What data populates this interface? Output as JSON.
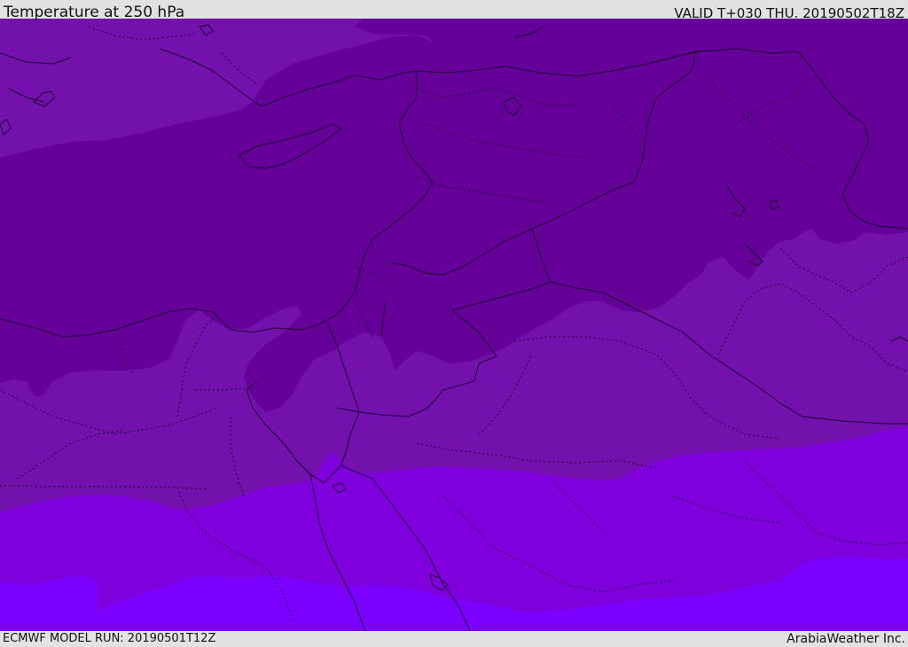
{
  "header": {
    "title": "Temperature at 250 hPa",
    "valid": "VALID T+030 THU. 20190502T18Z"
  },
  "footer": {
    "model_run": "ECMWF MODEL RUN: 20190501T12Z",
    "credit": "ArabiaWeather Inc."
  },
  "map": {
    "field": "temperature_250hPa",
    "palette": {
      "coldest": "#650098",
      "cold": "#7311ad",
      "mid": "#7f00dd",
      "warm": "#7a00ff"
    },
    "line_color": "#1a0030"
  }
}
